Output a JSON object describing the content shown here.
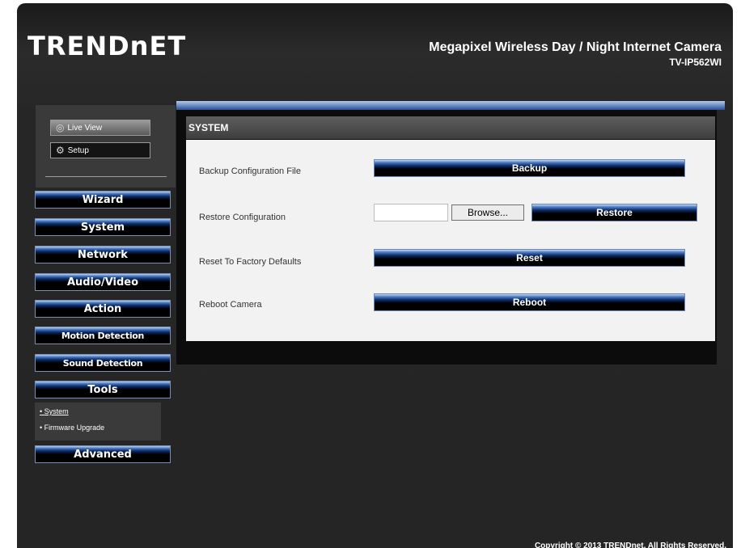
{
  "header": {
    "logo": "TRENDnET",
    "product_title": "Megapixel Wireless Day / Night Internet Camera",
    "model": "TV-IP562WI"
  },
  "view_buttons": {
    "live_view": "Live View",
    "setup": "Setup"
  },
  "nav": {
    "items": [
      {
        "label": "Wizard"
      },
      {
        "label": "System"
      },
      {
        "label": "Network"
      },
      {
        "label": "Audio/Video"
      },
      {
        "label": "Action"
      },
      {
        "label": "Motion Detection"
      },
      {
        "label": "Sound Detection"
      },
      {
        "label": "Tools"
      },
      {
        "label": "Advanced"
      }
    ],
    "tools_sub": {
      "system": "System",
      "firmware": "Firmware Upgrade"
    }
  },
  "main": {
    "section_title": "SYSTEM",
    "rows": {
      "backup": {
        "label": "Backup Configuration File",
        "button": "Backup"
      },
      "restore": {
        "label": "Restore Configuration",
        "browse": "Browse...",
        "button": "Restore"
      },
      "reset": {
        "label": "Reset To Factory Defaults",
        "button": "Reset"
      },
      "reboot": {
        "label": "Reboot Camera",
        "button": "Reboot"
      }
    }
  },
  "footer": {
    "copyright": "Copyright © 2013 TRENDnet. All Rights Reserved."
  },
  "colors": {
    "background": "#252525",
    "accent_blue": "#3d6fb8",
    "panel": "#f2f2f2"
  }
}
